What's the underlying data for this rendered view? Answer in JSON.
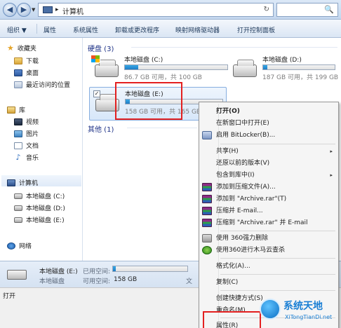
{
  "address_bar": {
    "breadcrumb_1": "▸",
    "location": "计算机",
    "separator": "▸",
    "refresh": "↻",
    "search": "🔍"
  },
  "toolbar": {
    "organize": "组织 ▼",
    "properties": "属性",
    "system_properties": "系统属性",
    "uninstall": "卸载或更改程序",
    "map_drive": "映射网络驱动器",
    "control_panel": "打开控制面板"
  },
  "sidebar": {
    "favorites": "收藏夹",
    "favorites_items": [
      "下载",
      "桌面",
      "最近访问的位置"
    ],
    "libraries": "库",
    "libraries_items": [
      "视频",
      "图片",
      "文档",
      "音乐"
    ],
    "computer": "计算机",
    "computer_items": [
      "本地磁盘 (C:)",
      "本地磁盘 (D:)",
      "本地磁盘 (E:)"
    ],
    "network": "网络"
  },
  "content": {
    "hard_disks_group": "硬盘 (3)",
    "other_group": "其他 (1)",
    "drives": [
      {
        "name": "本地磁盘 (C:)",
        "info": "86.7 GB 可用，共 100 GB",
        "used_fraction": 0.13
      },
      {
        "name": "本地磁盘 (D:)",
        "info": "187 GB 可用，共 199 GB",
        "used_fraction": 0.06
      },
      {
        "name": "本地磁盘 (E:)",
        "info": "158 GB 可用，共 165 GB",
        "used_fraction": 0.04
      }
    ],
    "checkbox": "✓"
  },
  "status_bar": {
    "name": "本地磁盘 (E:)",
    "drive_type": "本地磁盘",
    "used_label": "已用空间:",
    "free_label": "可用空间:",
    "free_value": "158 GB",
    "file_label": "文",
    "used_fraction": 0.04
  },
  "footer": {
    "status_text": "打开"
  },
  "context_menu": {
    "items": [
      "打开(O)",
      "在新窗口中打开(E)",
      "启用 BitLocker(B)...",
      "共享(H)",
      "还原以前的版本(V)",
      "包含到库中(I)",
      "添加到压缩文件(A)...",
      "添加到 \"Archive.rar\"(T)",
      "压缩并 E-mail...",
      "压缩到 \"Archive.rar\" 并 E-mail",
      "使用 360强力删除",
      "使用360进行木马云查杀",
      "格式化(A)...",
      "复制(C)",
      "创建快捷方式(S)",
      "重命名(M)",
      "属性(R)"
    ],
    "submenu_arrow": "▸"
  },
  "watermark": {
    "title": "系统天地",
    "subtitle": "XiTongTianDi.net"
  }
}
